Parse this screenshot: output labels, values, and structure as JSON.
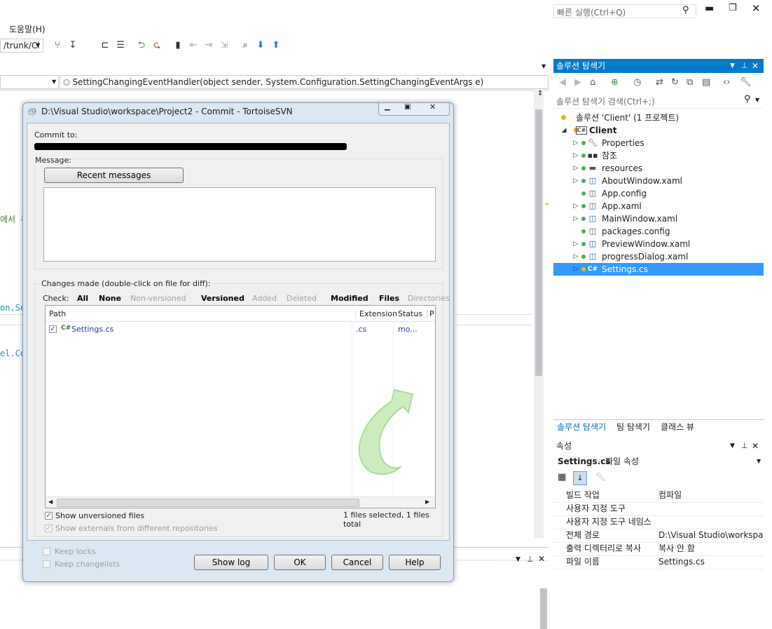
{
  "vs": {
    "quick_launch_placeholder": "빠른 실행(Ctrl+Q)",
    "menu_help": "도움말(H)",
    "branch_combo": "/trunk/Cl",
    "nav_member": "SettingChangingEventHandler(object sender, System.Configuration.SettingChangingEventArgs e)",
    "code_fragments": [
      "에서 주",
      "on.Se",
      "el.Co"
    ]
  },
  "solution_explorer": {
    "title": "솔루션 탐색기",
    "search_placeholder": "솔루션 탐색기 검색(Ctrl+;)",
    "solution_label": "솔루션 'Client' (1 프로젝트)",
    "project": "Client",
    "items": [
      {
        "label": "Properties",
        "icon": "wrench-icon",
        "arrow": true
      },
      {
        "label": "참조",
        "icon": "references-icon",
        "arrow": true
      },
      {
        "label": "resources",
        "icon": "folder-icon",
        "arrow": true
      },
      {
        "label": "AboutWindow.xaml",
        "icon": "xaml-file-icon",
        "arrow": true
      },
      {
        "label": "App.config",
        "icon": "config-file-icon",
        "arrow": false
      },
      {
        "label": "App.xaml",
        "icon": "xaml-file-icon",
        "arrow": true
      },
      {
        "label": "MainWindow.xaml",
        "icon": "xaml-file-icon",
        "arrow": true
      },
      {
        "label": "packages.config",
        "icon": "config-file-icon",
        "arrow": false
      },
      {
        "label": "PreviewWindow.xaml",
        "icon": "xaml-file-icon",
        "arrow": true
      },
      {
        "label": "progressDialog.xaml",
        "icon": "xaml-file-icon",
        "arrow": true
      },
      {
        "label": "Settings.cs",
        "icon": "csharp-file-icon",
        "arrow": true,
        "selected": true
      }
    ],
    "bottom_tabs": [
      "솔루션 탐색기",
      "팀 탐색기",
      "클래스 뷰"
    ]
  },
  "properties": {
    "title": "속성",
    "object_name": "Settings.cs",
    "object_type": "파일 속성",
    "rows": [
      {
        "name": "빌드 작업",
        "value": "컴파일"
      },
      {
        "name": "사용자 지정 도구",
        "value": ""
      },
      {
        "name": "사용자 지정 도구 네임스",
        "value": ""
      },
      {
        "name": "전체 경로",
        "value": "D:\\Visual Studio\\workspac"
      },
      {
        "name": "출력 디렉터리로 복사",
        "value": "복사 안 함"
      },
      {
        "name": "파일 이름",
        "value": "Settings.cs"
      }
    ]
  },
  "dialog": {
    "title": "D:\\Visual Studio\\workspace\\Project2 - Commit - TortoiseSVN",
    "commit_to_label": "Commit to:",
    "message_label": "Message:",
    "recent_messages": "Recent messages",
    "changes_label": "Changes made (double-click on file for diff):",
    "check_label": "Check:",
    "filters": [
      {
        "label": "All",
        "enabled": true
      },
      {
        "label": "None",
        "enabled": true
      },
      {
        "label": "Non-versioned",
        "enabled": false
      },
      {
        "label": "Versioned",
        "enabled": true
      },
      {
        "label": "Added",
        "enabled": false
      },
      {
        "label": "Deleted",
        "enabled": false
      },
      {
        "label": "Modified",
        "enabled": true
      },
      {
        "label": "Files",
        "enabled": true
      },
      {
        "label": "Directories",
        "enabled": false
      }
    ],
    "columns": [
      "Path",
      "Extension",
      "Status",
      "P"
    ],
    "files": [
      {
        "checked": true,
        "path": "Settings.cs",
        "extension": ".cs",
        "status": "mo..."
      }
    ],
    "show_unversioned": "Show unversioned files",
    "show_externals": "Show externals from different repositories",
    "selection_summary": "1 files selected, 1 files total",
    "keep_locks": "Keep locks",
    "keep_changelists": "Keep changelists",
    "buttons": {
      "show_log": "Show log",
      "ok": "OK",
      "cancel": "Cancel",
      "help": "Help"
    }
  }
}
